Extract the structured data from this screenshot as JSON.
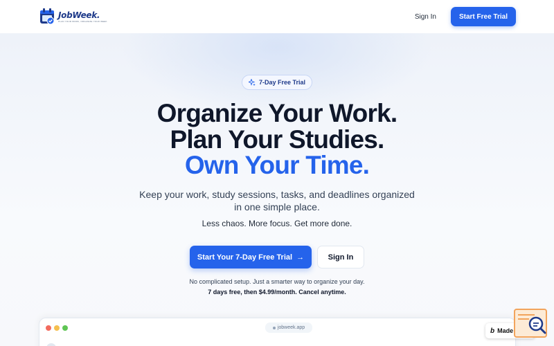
{
  "nav": {
    "logo_word": "JobWeek.",
    "logo_tagline": "Plan your work, organize your week",
    "signin_label": "Sign In",
    "cta_label": "Start Free Trial"
  },
  "hero": {
    "badge_icon": "sparkles-icon",
    "badge_label": "7-Day Free Trial",
    "headline_1": "Organize Your Work.",
    "headline_2": "Plan Your Studies.",
    "headline_3": "Own Your Time.",
    "subtext": "Keep your work, study sessions, tasks, and deadlines organized in one simple place.",
    "tagline": "Less chaos. More focus. Get more done.",
    "primary_cta": "Start Your 7-Day Free Trial",
    "primary_cta_icon": "arrow-right-icon",
    "secondary_cta": "Sign In",
    "note_1": "No complicated setup. Just a smarter way to organize your day.",
    "note_2": "7 days free, then $4.99/month. Cancel anytime."
  },
  "preview": {
    "url": "jobweek.app"
  },
  "made_in": {
    "label": "Made in B"
  },
  "colors": {
    "accent": "#2563eb",
    "heading": "#0f172a",
    "background": "#f6f8fc",
    "widget_orange": "#f2a45c"
  }
}
